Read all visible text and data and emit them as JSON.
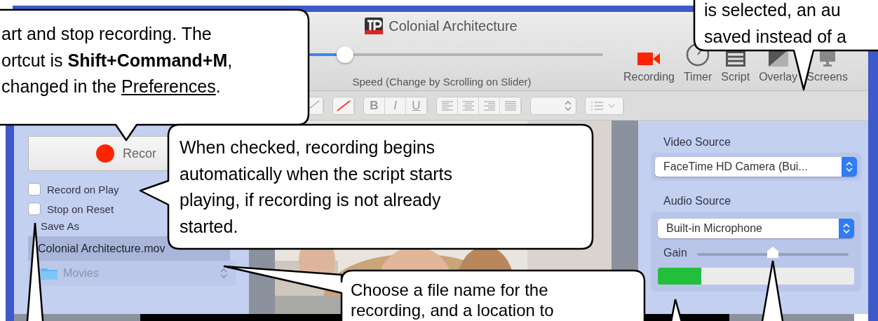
{
  "window": {
    "title": "Colonial Architecture"
  },
  "toolbar": {
    "speed_slider": {
      "level": 0.2
    },
    "speed_label": "Speed (Change by Scrolling on Slider)",
    "items": [
      {
        "label": "Recording",
        "kind": "camera"
      },
      {
        "label": "Timer",
        "kind": "timer"
      },
      {
        "label": "Script",
        "kind": "script"
      },
      {
        "label": "Overlay",
        "kind": "overlay"
      },
      {
        "label": "Screens",
        "kind": "screens"
      }
    ]
  },
  "format_bar": {
    "styles": [
      "B",
      "I",
      "U"
    ]
  },
  "recording_panel": {
    "record_button": "Recor",
    "options": [
      {
        "label": "Record on Play",
        "checked": false
      },
      {
        "label": "Stop on Reset",
        "checked": false
      }
    ],
    "save_as_label": "Save As",
    "file_name": "Colonial Architecture.mov",
    "location": "Movies"
  },
  "sources_panel": {
    "video_source_label": "Video Source",
    "video_source": "FaceTime HD Camera (Bui...",
    "audio_source_label": "Audio Source",
    "audio_source": "Built-in Microphone",
    "gain_label": "Gain",
    "gain": {
      "level": 0.5
    },
    "input_meter": {
      "level": 0.22
    }
  },
  "callouts": [
    {
      "lines": [
        {
          "text": "art and stop recording. The"
        },
        {
          "text": "ortcut is **Shift+Command+M**,"
        },
        {
          "text": "changed in the ",
          "link": "Preferences",
          "after": "."
        }
      ]
    },
    {
      "lines": [
        {
          "text": "When checked, recording begins"
        },
        {
          "text": "automatically when the script starts"
        },
        {
          "text": "playing, if recording is not already"
        },
        {
          "text": "started."
        }
      ]
    },
    {
      "lines": [
        {
          "text": "is selected, an au"
        },
        {
          "text": "saved instead of a"
        }
      ]
    },
    {
      "lines": [
        {
          "text": "Choose a file name for the"
        },
        {
          "text": "recording, and a location to"
        }
      ]
    }
  ]
}
